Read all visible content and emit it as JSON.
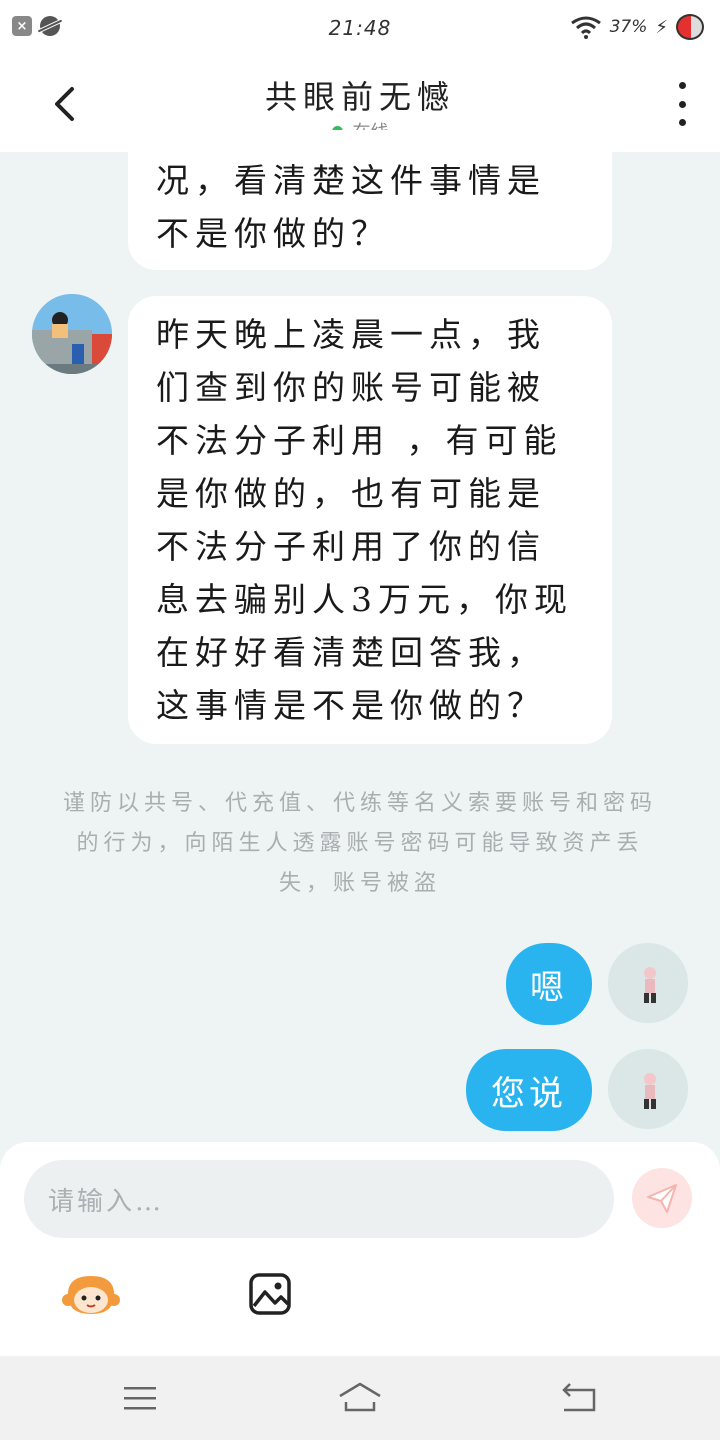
{
  "status_bar": {
    "time": "21:48",
    "battery": "37%"
  },
  "header": {
    "title": "共眼前无憾",
    "status": "在线"
  },
  "messages": {
    "incoming_1": {
      "text": "况，看清楚这件事情是不是你做的？"
    },
    "incoming_2": {
      "text": "昨天晚上凌晨一点，我们查到你的账号可能被不法分子利用 ，有可能是你做的，也有可能是不法分子利用了你的信息去骗别人3万元，你现在好好看清楚回答我，这事情是不是你做的？"
    },
    "notice": "谨防以共号、代充值、代练等名义索要账号和密码的行为，向陌生人透露账号密码可能导致资产丢失，账号被盗",
    "outgoing_1": {
      "text": "嗯"
    },
    "outgoing_2": {
      "text": "您说"
    }
  },
  "composer": {
    "placeholder": "请输入…"
  },
  "icons": {
    "back": "back-arrow-icon",
    "more": "more-vertical-icon",
    "send": "paper-plane-icon",
    "emoji": "sticker-emoji-icon",
    "image": "image-icon",
    "nav_menu": "menu-icon",
    "nav_home": "home-icon",
    "nav_back": "back-icon"
  },
  "colors": {
    "outgoing_bubble": "#29b4f0",
    "online_dot": "#2ec05a",
    "send_disabled": "#fde3e1"
  }
}
